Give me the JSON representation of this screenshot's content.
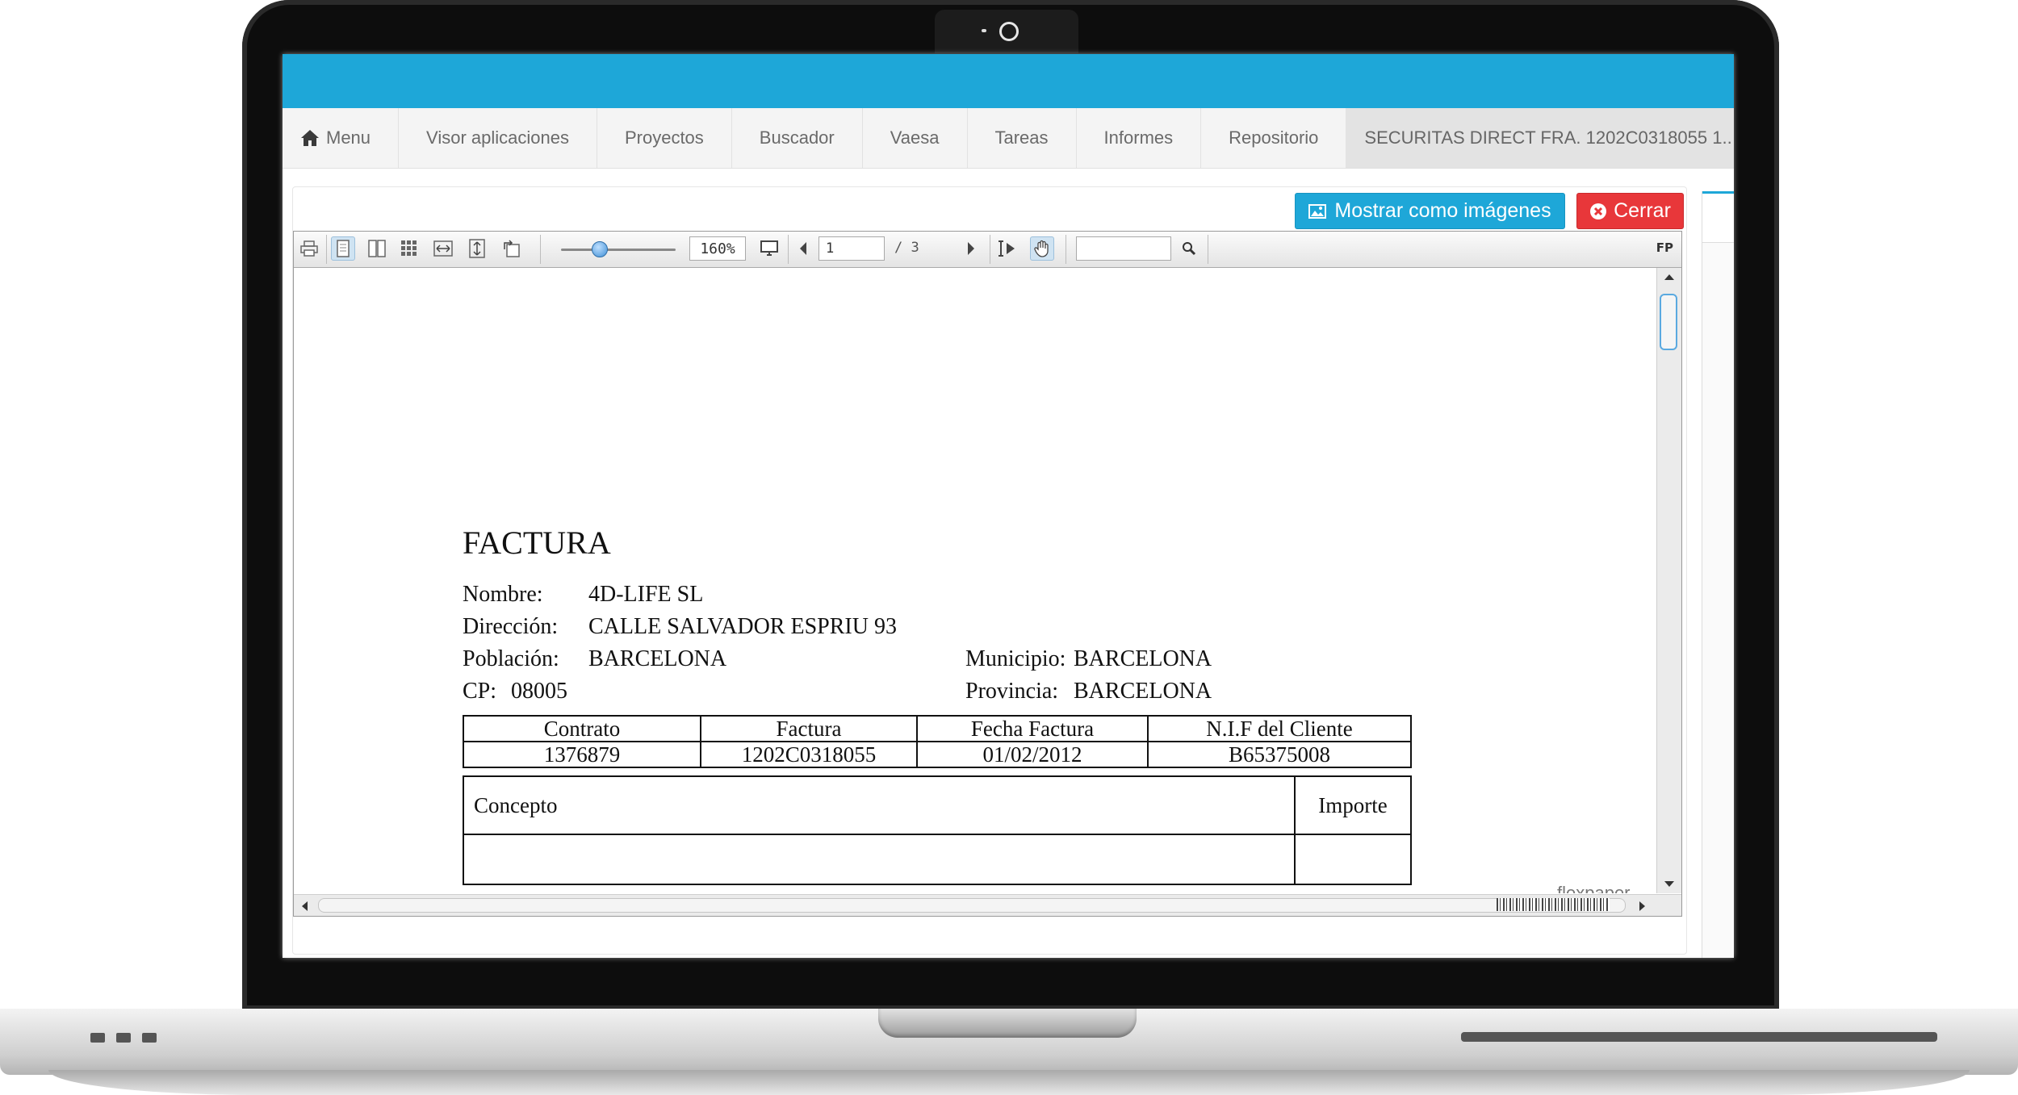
{
  "nav": {
    "items": [
      {
        "label": "Menu"
      },
      {
        "label": "Visor aplicaciones"
      },
      {
        "label": "Proyectos"
      },
      {
        "label": "Buscador"
      },
      {
        "label": "Vaesa"
      },
      {
        "label": "Tareas"
      },
      {
        "label": "Informes"
      },
      {
        "label": "Repositorio"
      }
    ],
    "active_tab": "SECURITAS DIRECT FRA. 1202C0318055 1..."
  },
  "buttons": {
    "show_images": "Mostrar como imágenes",
    "close": "Cerrar"
  },
  "viewer": {
    "zoom": "160%",
    "page_current": "1",
    "page_total": "/  3",
    "search_placeholder": "",
    "badge": "FP",
    "watermark": "flexpaper"
  },
  "document": {
    "title": "FACTURA",
    "fields": {
      "nombre_label": "Nombre:",
      "nombre": "4D-LIFE SL",
      "direccion_label": "Dirección:",
      "direccion": "CALLE SALVADOR ESPRIU 93",
      "poblacion_label": "Población:",
      "poblacion": "BARCELONA",
      "municipio_label": "Municipio:",
      "municipio": "BARCELONA",
      "cp_label": "CP:",
      "cp": "08005",
      "provincia_label": "Provincia:",
      "provincia": "BARCELONA"
    },
    "invoice_table": {
      "headers": [
        "Contrato",
        "Factura",
        "Fecha Factura",
        "N.I.F del Cliente"
      ],
      "row": [
        "1376879",
        "1202C0318055",
        "01/02/2012",
        "B65375008"
      ]
    },
    "concept_table": {
      "headers": [
        "Concepto",
        "Importe"
      ]
    }
  }
}
